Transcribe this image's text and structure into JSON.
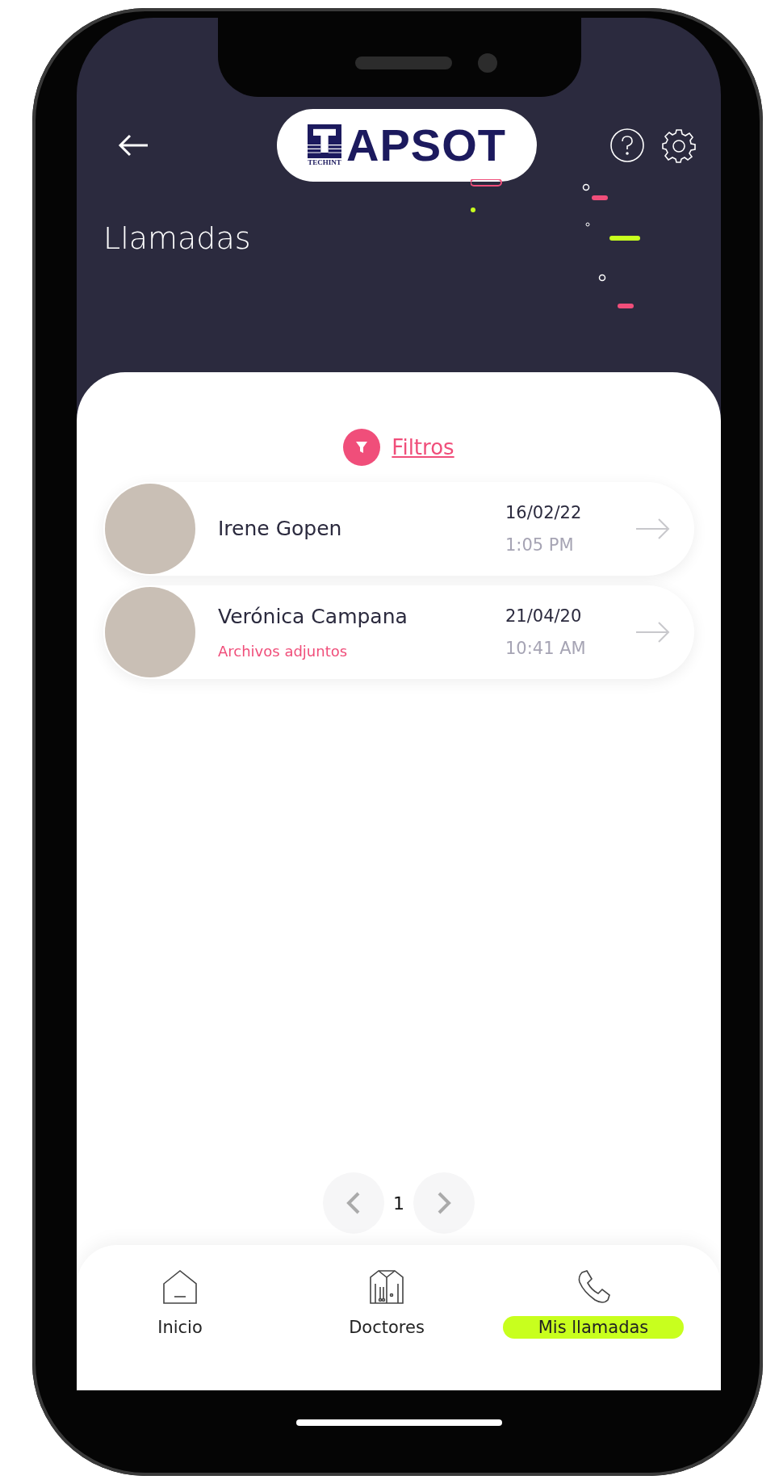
{
  "header": {
    "logo": {
      "name": "APSOT",
      "subtext": "TECHINT"
    },
    "title": "Llamadas"
  },
  "filter": {
    "label": "Filtros"
  },
  "calls": [
    {
      "name": "Irene Gopen",
      "date": "16/02/22",
      "time": "1:05 PM"
    },
    {
      "name": "Verónica Campana",
      "date": "21/04/20",
      "time": "10:41 AM",
      "attachments": "Archivos adjuntos"
    }
  ],
  "pagination": {
    "page": "1"
  },
  "nav": [
    {
      "label": "Inicio",
      "kind": "home",
      "selected": false
    },
    {
      "label": "Doctores",
      "kind": "doctors",
      "selected": false
    },
    {
      "label": "Mis llamadas",
      "kind": "phone",
      "selected": true
    }
  ]
}
